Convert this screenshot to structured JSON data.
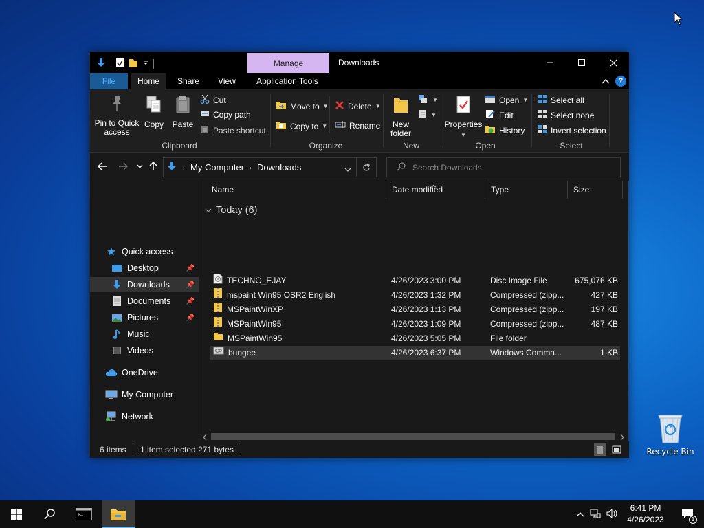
{
  "desktop": {
    "recycle_bin_label": "Recycle Bin"
  },
  "window": {
    "title": "Downloads",
    "manage_tab": "Manage",
    "tabs": {
      "file": "File",
      "home": "Home",
      "share": "Share",
      "view": "View",
      "app_tools": "Application Tools"
    },
    "ribbon": {
      "clipboard": {
        "label": "Clipboard",
        "pin": "Pin to Quick access",
        "pin_line1": "Pin to Quick",
        "pin_line2": "access",
        "copy": "Copy",
        "paste": "Paste",
        "cut": "Cut",
        "copy_path": "Copy path",
        "paste_shortcut": "Paste shortcut"
      },
      "organize": {
        "label": "Organize",
        "move_to": "Move to",
        "copy_to": "Copy to",
        "delete": "Delete",
        "rename": "Rename"
      },
      "new": {
        "label": "New",
        "new_folder_line1": "New",
        "new_folder_line2": "folder"
      },
      "open": {
        "label": "Open",
        "properties": "Properties",
        "open": "Open",
        "edit": "Edit",
        "history": "History"
      },
      "select": {
        "label": "Select",
        "select_all": "Select all",
        "select_none": "Select none",
        "invert": "Invert selection"
      }
    },
    "address": {
      "crumbs": [
        "My Computer",
        "Downloads"
      ],
      "search_placeholder": "Search Downloads"
    },
    "nav": {
      "quick_access": "Quick access",
      "items": [
        {
          "label": "Desktop",
          "pinned": true
        },
        {
          "label": "Downloads",
          "pinned": true,
          "selected": true
        },
        {
          "label": "Documents",
          "pinned": true
        },
        {
          "label": "Pictures",
          "pinned": true
        },
        {
          "label": "Music",
          "pinned": false
        },
        {
          "label": "Videos",
          "pinned": false
        }
      ],
      "onedrive": "OneDrive",
      "my_computer": "My Computer",
      "network": "Network"
    },
    "columns": {
      "name": "Name",
      "date": "Date modified",
      "type": "Type",
      "size": "Size"
    },
    "group": "Today (6)",
    "files": [
      {
        "name": "TECHNO_EJAY",
        "date": "4/26/2023 3:00 PM",
        "type": "Disc Image File",
        "size": "675,076 KB",
        "icon": "disc-image-icon"
      },
      {
        "name": "mspaint Win95 OSR2 English",
        "date": "4/26/2023 1:32 PM",
        "type": "Compressed (zipp...",
        "size": "427 KB",
        "icon": "zip-folder-icon"
      },
      {
        "name": "MSPaintWinXP",
        "date": "4/26/2023 1:13 PM",
        "type": "Compressed (zipp...",
        "size": "197 KB",
        "icon": "zip-folder-icon"
      },
      {
        "name": "MSPaintWin95",
        "date": "4/26/2023 1:09 PM",
        "type": "Compressed (zipp...",
        "size": "487 KB",
        "icon": "zip-folder-icon"
      },
      {
        "name": "MSPaintWin95",
        "date": "4/26/2023 5:05 PM",
        "type": "File folder",
        "size": "",
        "icon": "folder-icon"
      },
      {
        "name": "bungee",
        "date": "4/26/2023 6:37 PM",
        "type": "Windows Comma...",
        "size": "1 KB",
        "icon": "batch-file-icon",
        "selected": true
      }
    ],
    "status": {
      "items": "6 items",
      "selected": "1 item selected",
      "bytes": "271 bytes"
    }
  },
  "taskbar": {
    "time": "6:41 PM",
    "date": "4/26/2023",
    "notification_count": "1"
  }
}
